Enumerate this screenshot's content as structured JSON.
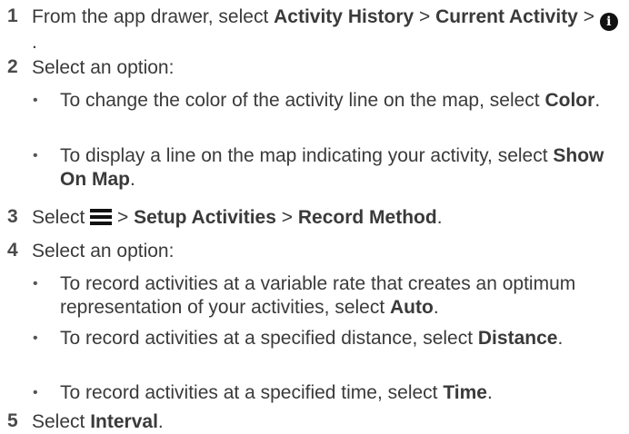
{
  "steps": [
    {
      "num": "1",
      "parts": [
        "From the app drawer, select ",
        "Activity History",
        " > ",
        "Current Activity",
        " > ",
        "."
      ],
      "icon": "info-icon"
    },
    {
      "num": "2",
      "text": "Select an option:",
      "bullets": [
        {
          "text": "To change the color of the activity line on the map, select ",
          "bold": "Color",
          "end": "."
        },
        {
          "text": "To display a line on the map indicating your activity, select ",
          "bold": "Show On Map",
          "end": "."
        }
      ]
    },
    {
      "num": "3",
      "parts": [
        "Select ",
        " > ",
        "Setup Activities",
        " > ",
        "Record Method",
        "."
      ],
      "icon": "menu-icon"
    },
    {
      "num": "4",
      "text": "Select an option:",
      "bullets": [
        {
          "text": "To record activities at a variable rate that creates an optimum representation of your activities, select ",
          "bold": "Auto",
          "end": "."
        },
        {
          "text": "To record activities at a specified distance, select ",
          "bold": "Distance",
          "end": "."
        },
        {
          "text": "To record activities at a specified time, select ",
          "bold": "Time",
          "end": "."
        }
      ]
    },
    {
      "num": "5",
      "parts": [
        "Select ",
        "Interval",
        "."
      ]
    }
  ],
  "bullet_char": "•"
}
